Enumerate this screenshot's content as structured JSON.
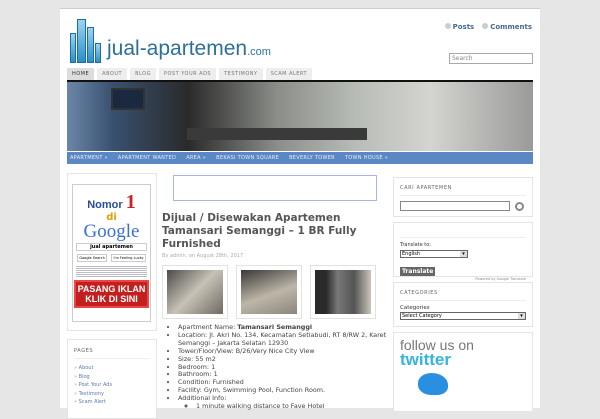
{
  "header": {
    "logo": "jual-apartemen",
    "logo_tld": ".com",
    "posts": "Posts",
    "comments": "Comments",
    "search_placeholder": "Search"
  },
  "tabs": [
    "HOME",
    "ABOUT",
    "BLOG",
    "POST YOUR ADS",
    "TESTIMONY",
    "SCAM ALERT"
  ],
  "catnav": [
    "APARTMENT »",
    "APARTMENT WANTED",
    "AREA »",
    "BEKASI TOWN SQUARE",
    "BEVERLY TOWER",
    "TOWN HOUSE »"
  ],
  "left": {
    "google_ad": {
      "nomor": "Nomor",
      "num": "1",
      "di": "di",
      "google": "Google",
      "query": "jual apartemen",
      "btn1": "Google Search",
      "btn2": "I'm Feeling Lucky",
      "pasang1": "PASANG IKLAN",
      "pasang2": "KLIK DI SINI"
    },
    "pages_title": "PAGES",
    "pages": [
      "About",
      "Blog",
      "Post Your Ads",
      "Testimony",
      "Scam Alert"
    ]
  },
  "post": {
    "title": "Dijual / Disewakan Apartemen Tamansari Semanggi – 1 BR Fully Furnished",
    "meta": "By admin, on August 28th, 2017",
    "items": [
      {
        "label": "Apartment Name: ",
        "bold": "Tamansari Semanggi"
      },
      {
        "label": "Location: Jl. Akri No. 134, Kecamatan Setiabudi, RT 8/RW 2, Karet Semanggi – Jakarta Selatan 12930"
      },
      {
        "label": "Tower/Floor/View: B/26/Very Nice City View"
      },
      {
        "label": "Size: 55 m2"
      },
      {
        "label": "Bedroom: 1"
      },
      {
        "label": "Bathroom: 1"
      },
      {
        "label": "Condition: Furnished"
      },
      {
        "label": "Facility: Gym, Swimming Pool, Function Room."
      },
      {
        "label": "Additional Info:"
      }
    ],
    "sub_items": [
      "1 minute walking distance to Fave Hotel"
    ]
  },
  "right": {
    "cari_title": "CARI APARTEMEN",
    "translate_label": "Translate to:",
    "language": "English",
    "translate_btn": "Translate",
    "powered": "Powered by Google Translate",
    "categories_title": "CATEGORIES",
    "categories_label": "Categories",
    "category_select": "Select Category",
    "follow": "follow us on",
    "twitter": "twitter"
  }
}
